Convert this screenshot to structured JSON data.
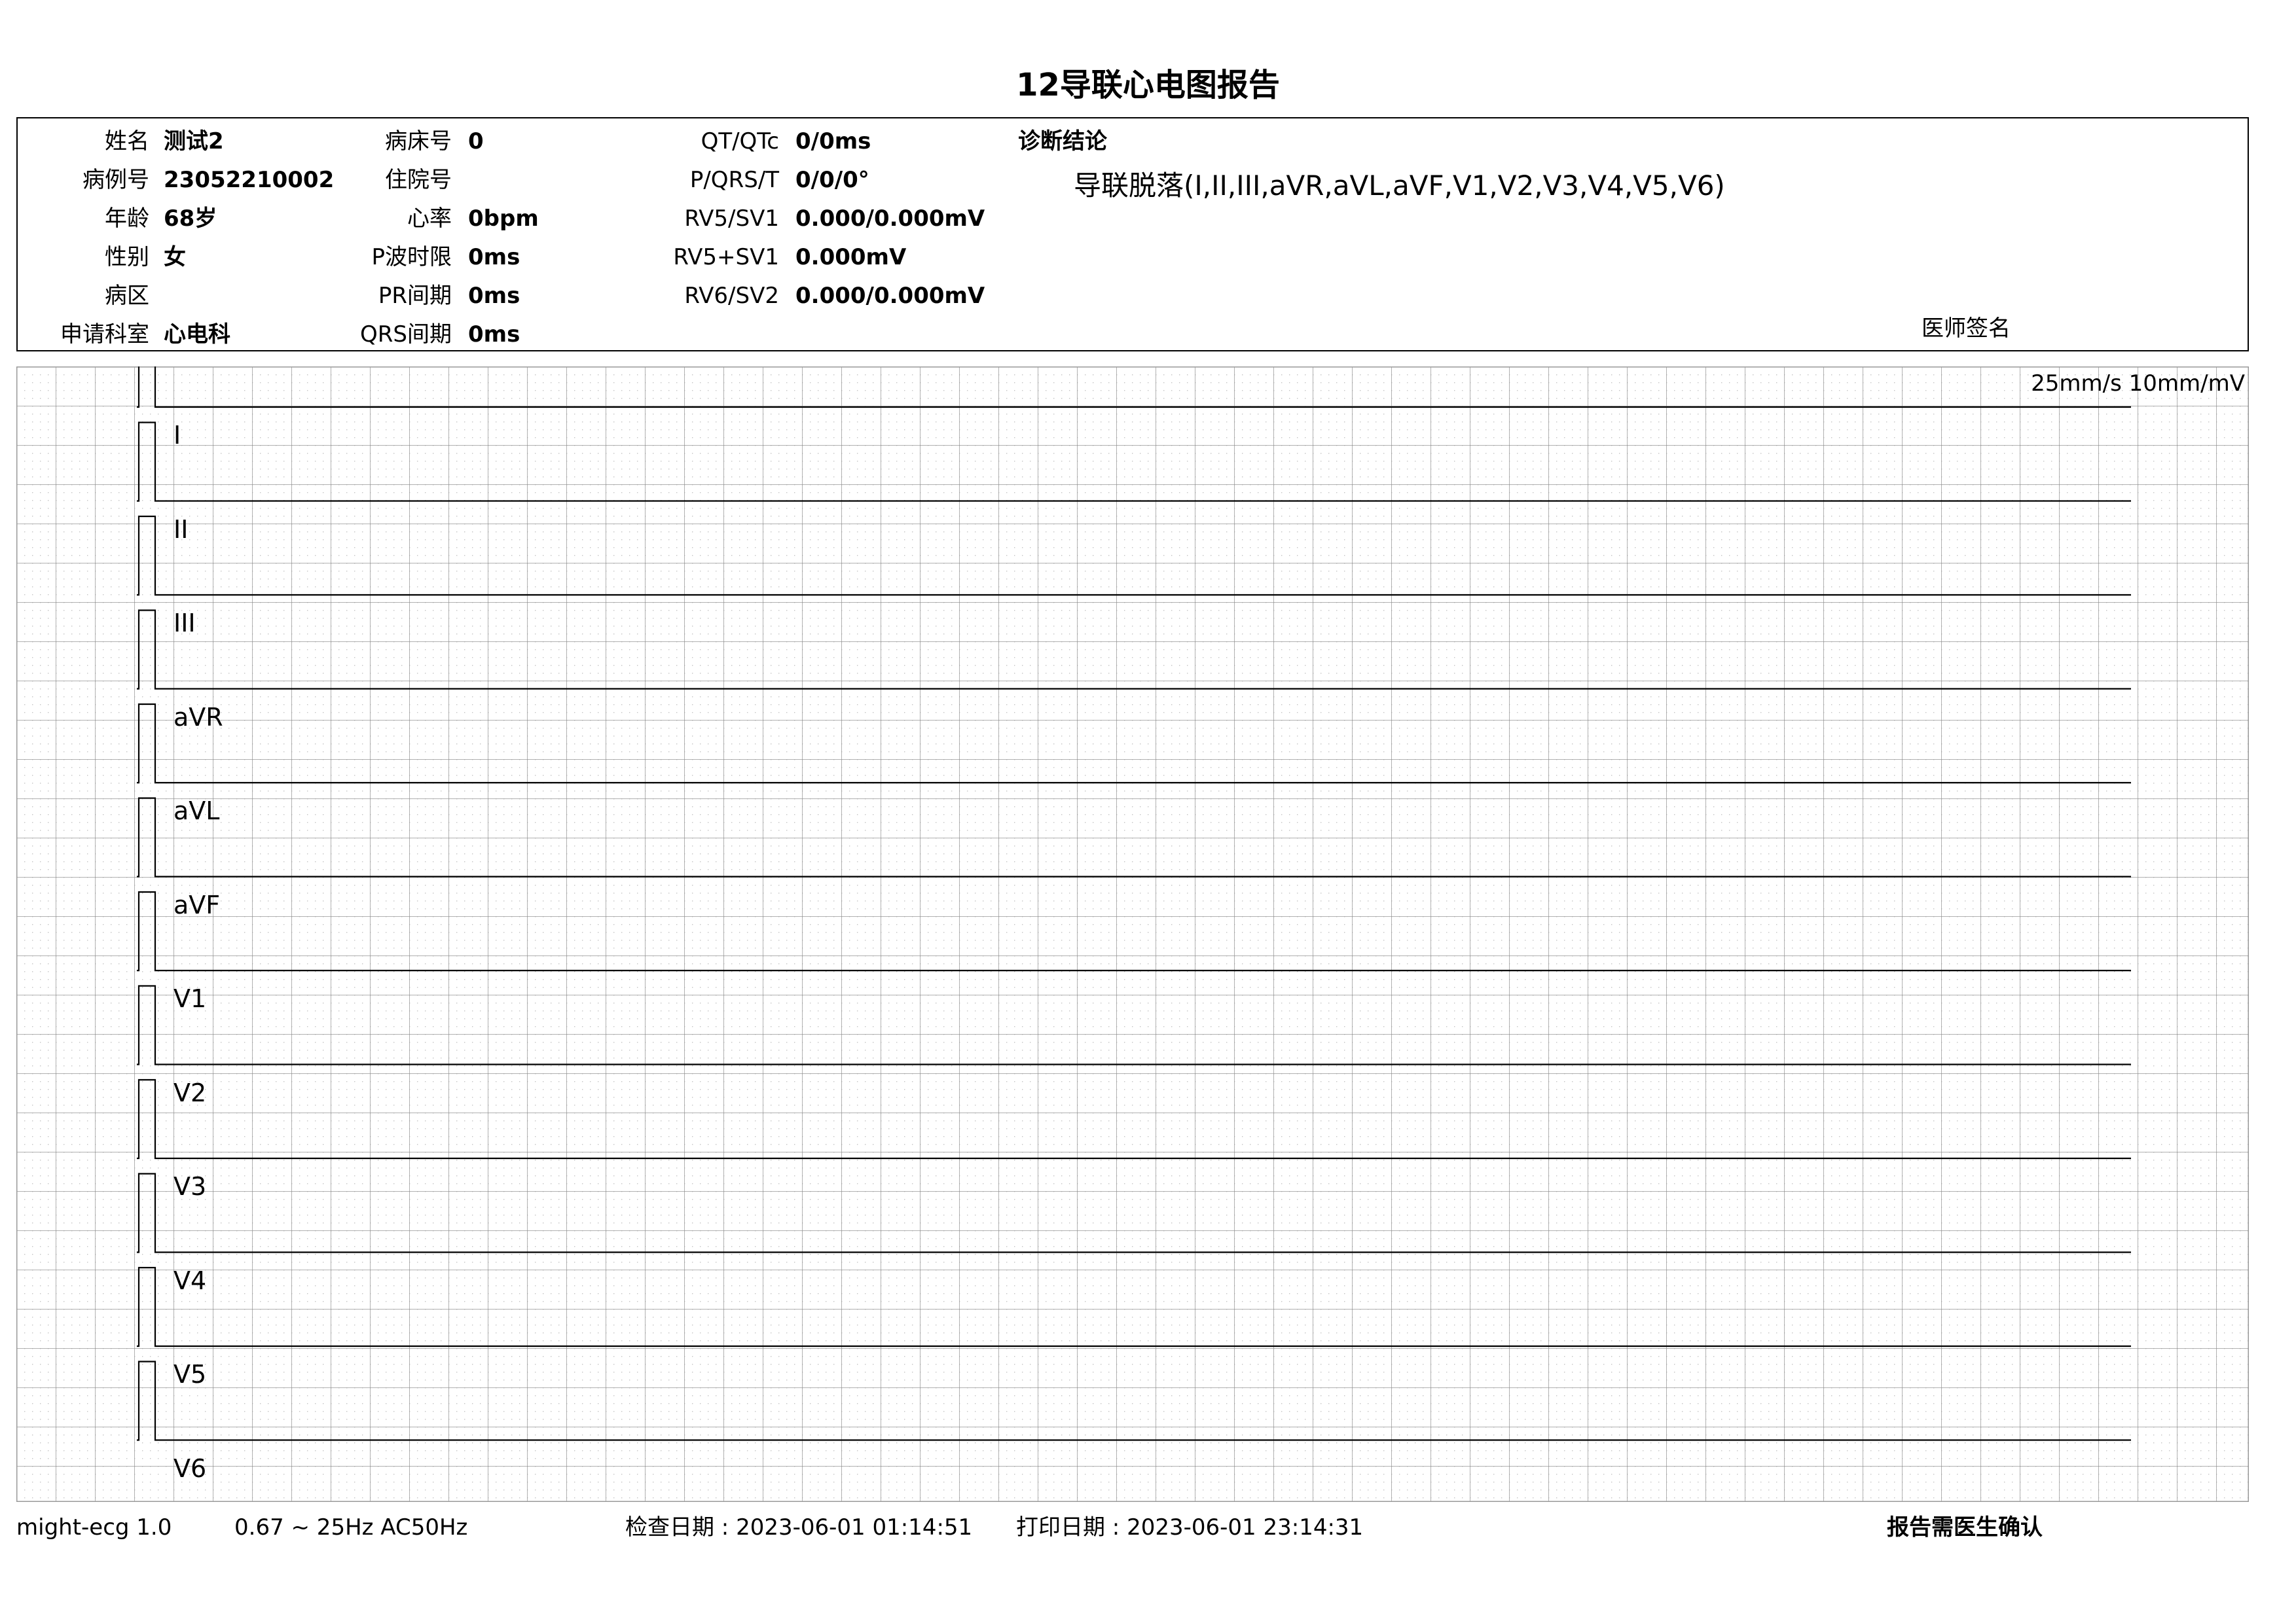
{
  "report": {
    "title": "12导联心电图报告"
  },
  "patient": {
    "name_label": "姓名",
    "name": "测试2",
    "case_label": "病例号",
    "case_no": "23052210002",
    "age_label": "年龄",
    "age": "68岁",
    "sex_label": "性别",
    "sex": "女",
    "ward_label": "病区",
    "ward": "",
    "dept_label": "申请科室",
    "dept": "心电科"
  },
  "admission": {
    "bed_label": "病床号",
    "bed": "0",
    "inpatient_label": "住院号",
    "inpatient": "",
    "hr_label": "心率",
    "hr": "0bpm",
    "pwave_label": "P波时限",
    "pwave": "0ms",
    "pr_label": "PR间期",
    "pr": "0ms",
    "qrs_label": "QRS间期",
    "qrs": "0ms"
  },
  "measurements": {
    "qt_label": "QT/QTc",
    "qt": "0/0ms",
    "axis_label": "P/QRS/T",
    "axis": "0/0/0°",
    "rv5sv1_label": "RV5/SV1",
    "rv5sv1": "0.000/0.000mV",
    "sum_label": "RV5+SV1",
    "sum": "0.000mV",
    "rv6sv2_label": "RV6/SV2",
    "rv6sv2": "0.000/0.000mV"
  },
  "diagnosis": {
    "title": "诊断结论",
    "text": "导联脱落(I,II,III,aVR,aVL,aVF,V1,V2,V3,V4,V5,V6)",
    "sign_label": "医师签名"
  },
  "ecg": {
    "speed_info": "25mm/s  10mm/mV",
    "leads": [
      "I",
      "II",
      "III",
      "aVR",
      "aVL",
      "aVF",
      "V1",
      "V2",
      "V3",
      "V4",
      "V5",
      "V6"
    ]
  },
  "footer": {
    "software": "might-ecg 1.0",
    "filter": "0.67 ~ 25Hz AC50Hz",
    "exam_date": "检查日期 : 2023-06-01 01:14:51",
    "print_date": "打印日期 : 2023-06-01 23:14:31",
    "confirm": "报告需医生确认"
  },
  "colors": {
    "grid_major": "#999999",
    "grid_minor": "#c4c4c4",
    "trace": "#000000"
  }
}
